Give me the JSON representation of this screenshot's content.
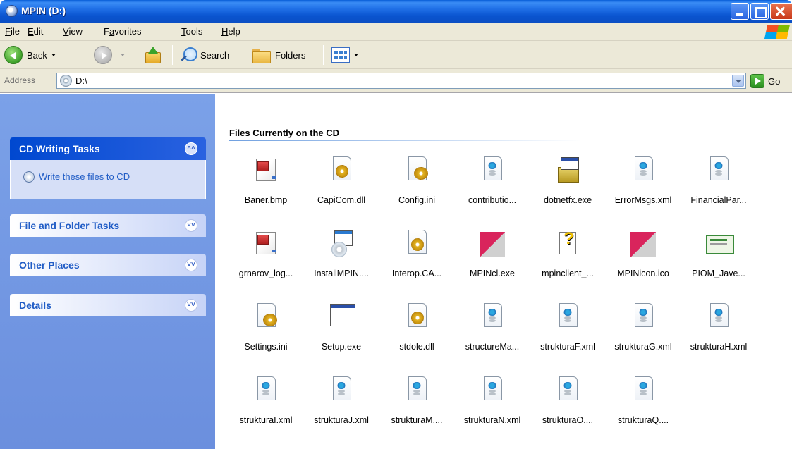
{
  "window": {
    "title": "MPIN (D:)"
  },
  "menu": [
    {
      "label": "File",
      "u": "F",
      "rest": "ile"
    },
    {
      "label": "Edit",
      "u": "E",
      "rest": "dit"
    },
    {
      "label": "View",
      "u": "V",
      "rest": "iew"
    },
    {
      "label": "Favorites",
      "u": "a",
      "pre": "F",
      "rest": "vorites"
    },
    {
      "label": "Tools",
      "u": "T",
      "rest": "ools"
    },
    {
      "label": "Help",
      "u": "H",
      "rest": "elp"
    }
  ],
  "toolbar": {
    "back_label": "Back",
    "search_label": "Search",
    "folders_label": "Folders"
  },
  "address": {
    "label": "Address",
    "value": "D:\\",
    "go_label": "Go"
  },
  "sidebar": {
    "cd_tasks": {
      "title": "CD Writing Tasks",
      "chevron": "˄˄",
      "task": "Write these files to CD"
    },
    "file_folder_tasks": {
      "title": "File and Folder Tasks",
      "chevron": "˅˅"
    },
    "other_places": {
      "title": "Other Places",
      "chevron": "˅˅"
    },
    "details": {
      "title": "Details",
      "chevron": "˅˅"
    }
  },
  "main": {
    "group_title": "Files Currently on the CD",
    "files": [
      {
        "name": "Baner.bmp",
        "icon": "paint-icon"
      },
      {
        "name": "CapiCom.dll",
        "icon": "dll-gear-icon"
      },
      {
        "name": "Config.ini",
        "icon": "ini-notes-icon"
      },
      {
        "name": "contributio...",
        "icon": "xml-file-icon"
      },
      {
        "name": "dotnetfx.exe",
        "icon": "setup-box-icon"
      },
      {
        "name": "ErrorMsgs.xml",
        "icon": "xml-file-icon"
      },
      {
        "name": "FinancialPar...",
        "icon": "xml-file-icon"
      },
      {
        "name": "grnarov_log...",
        "icon": "paint-icon"
      },
      {
        "name": "InstallMPIN....",
        "icon": "installer-icon"
      },
      {
        "name": "Interop.CA...",
        "icon": "dll-gear-icon"
      },
      {
        "name": "MPINcl.exe",
        "icon": "app-icon"
      },
      {
        "name": "mpinclient_...",
        "icon": "question-file-icon"
      },
      {
        "name": "MPINicon.ico",
        "icon": "app-icon"
      },
      {
        "name": "PIOM_Jave...",
        "icon": "certificate-icon"
      },
      {
        "name": "Settings.ini",
        "icon": "ini-notes-icon"
      },
      {
        "name": "Setup.exe",
        "icon": "exe-window-icon"
      },
      {
        "name": "stdole.dll",
        "icon": "dll-gear-icon"
      },
      {
        "name": "structureMa...",
        "icon": "xml-file-icon"
      },
      {
        "name": "strukturaF.xml",
        "icon": "xml-file-icon"
      },
      {
        "name": "strukturaG.xml",
        "icon": "xml-file-icon"
      },
      {
        "name": "strukturaH.xml",
        "icon": "xml-file-icon"
      },
      {
        "name": "strukturaI.xml",
        "icon": "xml-file-icon"
      },
      {
        "name": "strukturaJ.xml",
        "icon": "xml-file-icon"
      },
      {
        "name": "strukturaM....",
        "icon": "xml-file-icon"
      },
      {
        "name": "strukturaN.xml",
        "icon": "xml-file-icon"
      },
      {
        "name": "strukturaO....",
        "icon": "xml-file-icon"
      },
      {
        "name": "strukturaQ....",
        "icon": "xml-file-icon"
      }
    ]
  }
}
